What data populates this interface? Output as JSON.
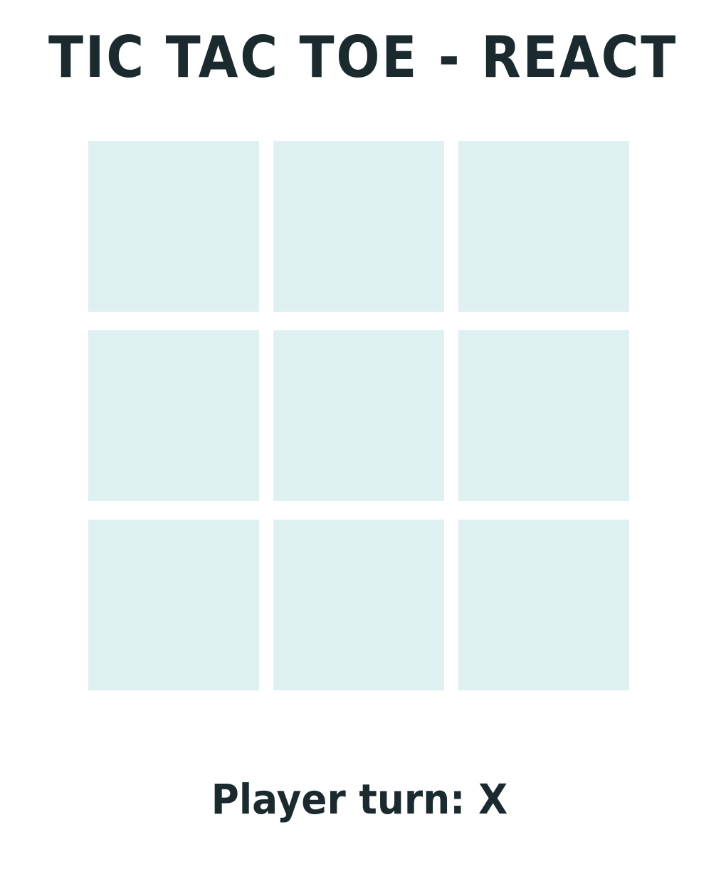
{
  "app": {
    "title": "TIC TAC TOE - REACT"
  },
  "board": {
    "cells": [
      "",
      "",
      "",
      "",
      "",
      "",
      "",
      "",
      ""
    ]
  },
  "status": {
    "text": "Player turn: X"
  },
  "colors": {
    "text": "#1b2a2e",
    "cell_background": "#dff0f0",
    "page_background": "#ffffff"
  }
}
